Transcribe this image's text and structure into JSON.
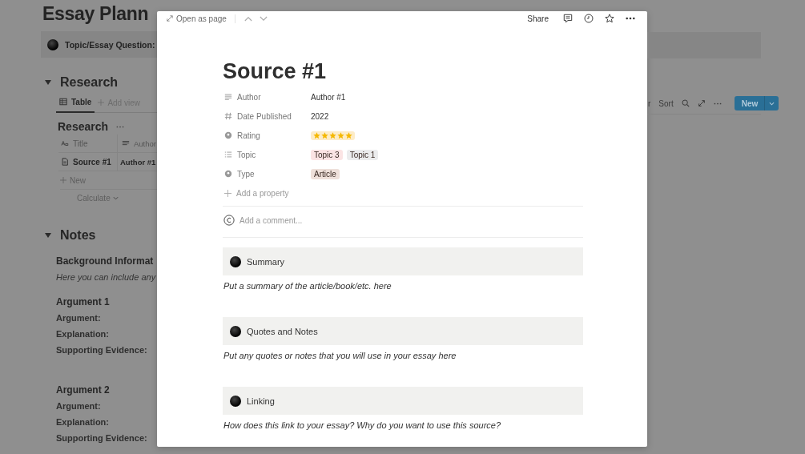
{
  "background": {
    "title": "Essay Plann",
    "callout": "Topic/Essay Question:",
    "research": {
      "heading": "Research",
      "views": [
        {
          "label": "Table",
          "selected": true
        }
      ],
      "add_view": "Add view",
      "database": {
        "title": "Research",
        "columns": [
          "Title",
          "Author"
        ],
        "rows": [
          [
            "Source #1",
            "Author #1"
          ]
        ],
        "new_row": "New",
        "calculate": "Calculate"
      },
      "toolbar": {
        "partial": "r",
        "sort": "Sort",
        "new_button": "New"
      }
    },
    "notes": {
      "heading": "Notes",
      "blocks": [
        {
          "kind": "heading",
          "text": "Background Informat"
        },
        {
          "kind": "italic",
          "text": "Here you can include any"
        },
        {
          "kind": "heading",
          "text": "Argument 1"
        },
        {
          "kind": "label",
          "text": "Argument:"
        },
        {
          "kind": "label",
          "text": "Explanation:"
        },
        {
          "kind": "label",
          "text": "Supporting Evidence:"
        },
        {
          "kind": "blank"
        },
        {
          "kind": "heading",
          "text": "Argument 2"
        },
        {
          "kind": "label",
          "text": "Argument:"
        },
        {
          "kind": "label",
          "text": "Explanation:"
        },
        {
          "kind": "label",
          "text": "Supporting Evidence:"
        }
      ]
    }
  },
  "modal": {
    "open_as_page": "Open as page",
    "share": "Share",
    "title": "Source #1",
    "properties": [
      {
        "kind": "text",
        "label": "Author",
        "value": "Author #1"
      },
      {
        "kind": "number",
        "label": "Date Published",
        "value": "2022"
      },
      {
        "kind": "rating",
        "label": "Rating",
        "stars": 5
      },
      {
        "kind": "multi_select",
        "label": "Topic",
        "tags": [
          {
            "text": "Topic 3",
            "color": "#fbe4e4"
          },
          {
            "text": "Topic 1",
            "color": "#ebeced"
          }
        ]
      },
      {
        "kind": "select",
        "label": "Type",
        "tags": [
          {
            "text": "Article",
            "color": "#eee0da"
          }
        ]
      }
    ],
    "add_property": "Add a property",
    "comment_placeholder": "Add a comment...",
    "sections": [
      {
        "title": "Summary",
        "body": "Put a summary of the article/book/etc. here"
      },
      {
        "title": "Quotes and Notes",
        "body": "Put any quotes or notes that you will use in your essay here"
      },
      {
        "title": "Linking",
        "body": "How does this link to your essay? Why do you want to use this source?"
      }
    ]
  }
}
